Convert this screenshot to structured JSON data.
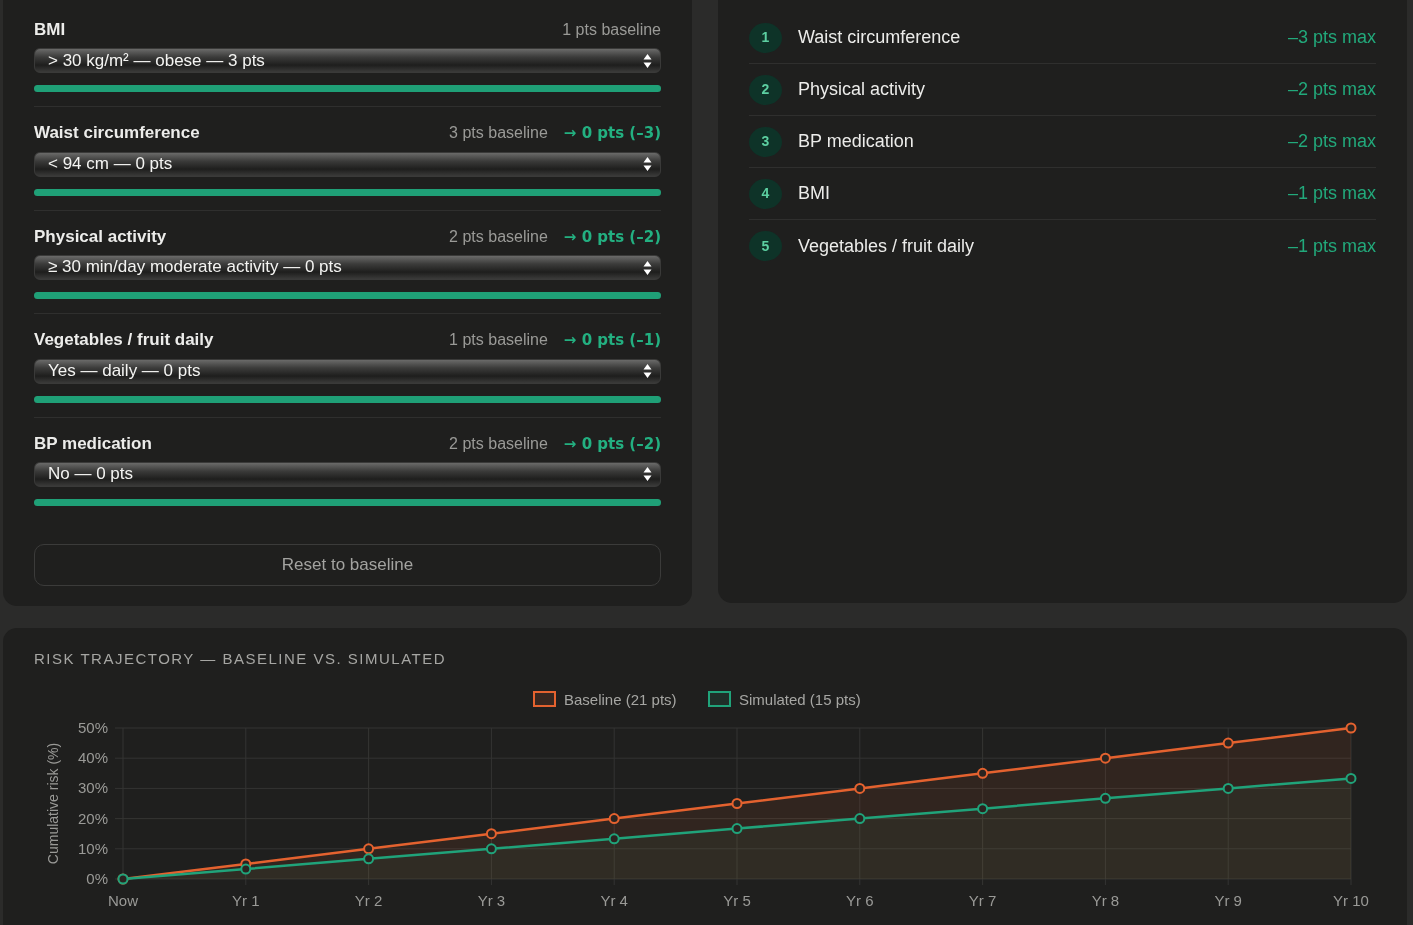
{
  "factors": [
    {
      "name": "BMI",
      "baseline": "1 pts baseline",
      "select": {
        "value": "> 30 kg/m² — obese — 3 pts"
      },
      "bar": {
        "level": 1
      }
    },
    {
      "name": "Waist circumference",
      "baseline": "3 pts baseline",
      "change": "→ 0 pts (–3)",
      "select": {
        "value": "< 94 cm — 0 pts"
      },
      "bar": {
        "level": 1
      }
    },
    {
      "name": "Physical activity",
      "baseline": "2 pts baseline",
      "change": "→ 0 pts (–2)",
      "select": {
        "value": "≥ 30 min/day moderate activity — 0 pts"
      },
      "bar": {
        "level": 1
      }
    },
    {
      "name": "Vegetables / fruit daily",
      "baseline": "1 pts baseline",
      "change": "→ 0 pts (–1)",
      "select": {
        "value": "Yes — daily — 0 pts"
      },
      "bar": {
        "level": 1
      }
    },
    {
      "name": "BP medication",
      "baseline": "2 pts baseline",
      "change": "→ 0 pts (–2)",
      "select": {
        "value": "No — 0 pts"
      },
      "bar": {
        "level": 1
      }
    }
  ],
  "reset_button": "Reset to baseline",
  "ranking": [
    {
      "rank": "1",
      "name": "Waist circumference",
      "impact": "–3 pts max"
    },
    {
      "rank": "2",
      "name": "Physical activity",
      "impact": "–2 pts max"
    },
    {
      "rank": "3",
      "name": "BP medication",
      "impact": "–2 pts max"
    },
    {
      "rank": "4",
      "name": "BMI",
      "impact": "–1 pts max"
    },
    {
      "rank": "5",
      "name": "Vegetables / fruit daily",
      "impact": "–1 pts max"
    }
  ],
  "trajectory": {
    "title": "RISK TRAJECTORY — BASELINE VS. SIMULATED",
    "chart_data": {
      "type": "line",
      "ylabel": "Cumulative risk (%)",
      "grid": true,
      "legend": true,
      "categories": [
        "Now",
        "Yr 1",
        "Yr 2",
        "Yr 3",
        "Yr 4",
        "Yr 5",
        "Yr 6",
        "Yr 7",
        "Yr 8",
        "Yr 9",
        "Yr 10"
      ],
      "series": [
        {
          "name": "Baseline (21 pts)",
          "color": "#e4622f",
          "marker": "circle",
          "values": [
            0,
            5,
            10,
            15,
            20,
            25,
            30,
            35,
            40,
            45,
            50
          ]
        },
        {
          "name": "Simulated (15 pts)",
          "color": "#20a37a",
          "marker": "circle",
          "values": [
            0,
            3.3,
            6.7,
            10,
            13.3,
            16.7,
            20,
            23.3,
            26.7,
            30,
            33.3
          ]
        }
      ],
      "ylim": [
        0,
        50
      ],
      "yticks": [
        {
          "value": 0,
          "label": "0%"
        },
        {
          "value": 10,
          "label": "10%"
        },
        {
          "value": 20,
          "label": "20%"
        },
        {
          "value": 30,
          "label": "30%"
        },
        {
          "value": 40,
          "label": "40%"
        },
        {
          "value": 50,
          "label": "50%"
        }
      ]
    }
  }
}
